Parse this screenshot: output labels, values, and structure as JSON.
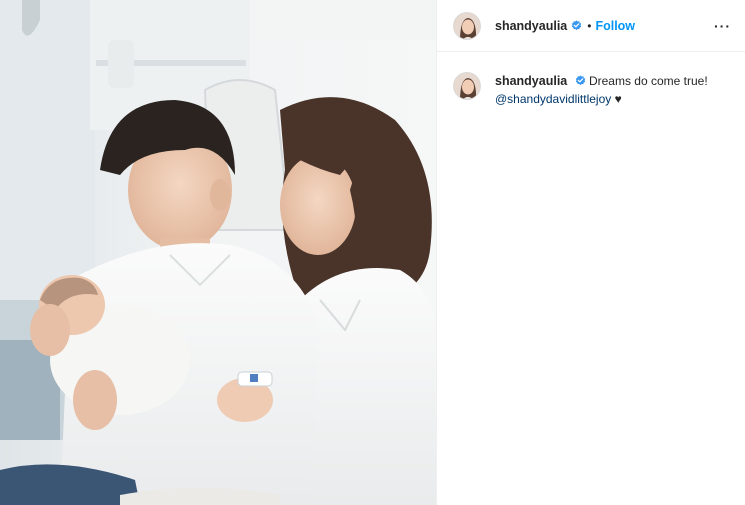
{
  "post": {
    "username": "shandyaulia",
    "verified_icon": "verified-badge-icon",
    "separator": "•",
    "follow_label": "Follow",
    "more_icon": "more-options-icon",
    "more_label": "···",
    "caption": {
      "username": "shandyaulia",
      "text": "Dreams do come true!",
      "mention": "@shandydavidlittlejoy",
      "trailing": "♥"
    },
    "photo": {
      "subject": "parents-holding-newborn-photo"
    }
  },
  "colors": {
    "accent": "#0095f6",
    "verified": "#3897f0",
    "mention": "#00376b",
    "text": "#262626"
  }
}
